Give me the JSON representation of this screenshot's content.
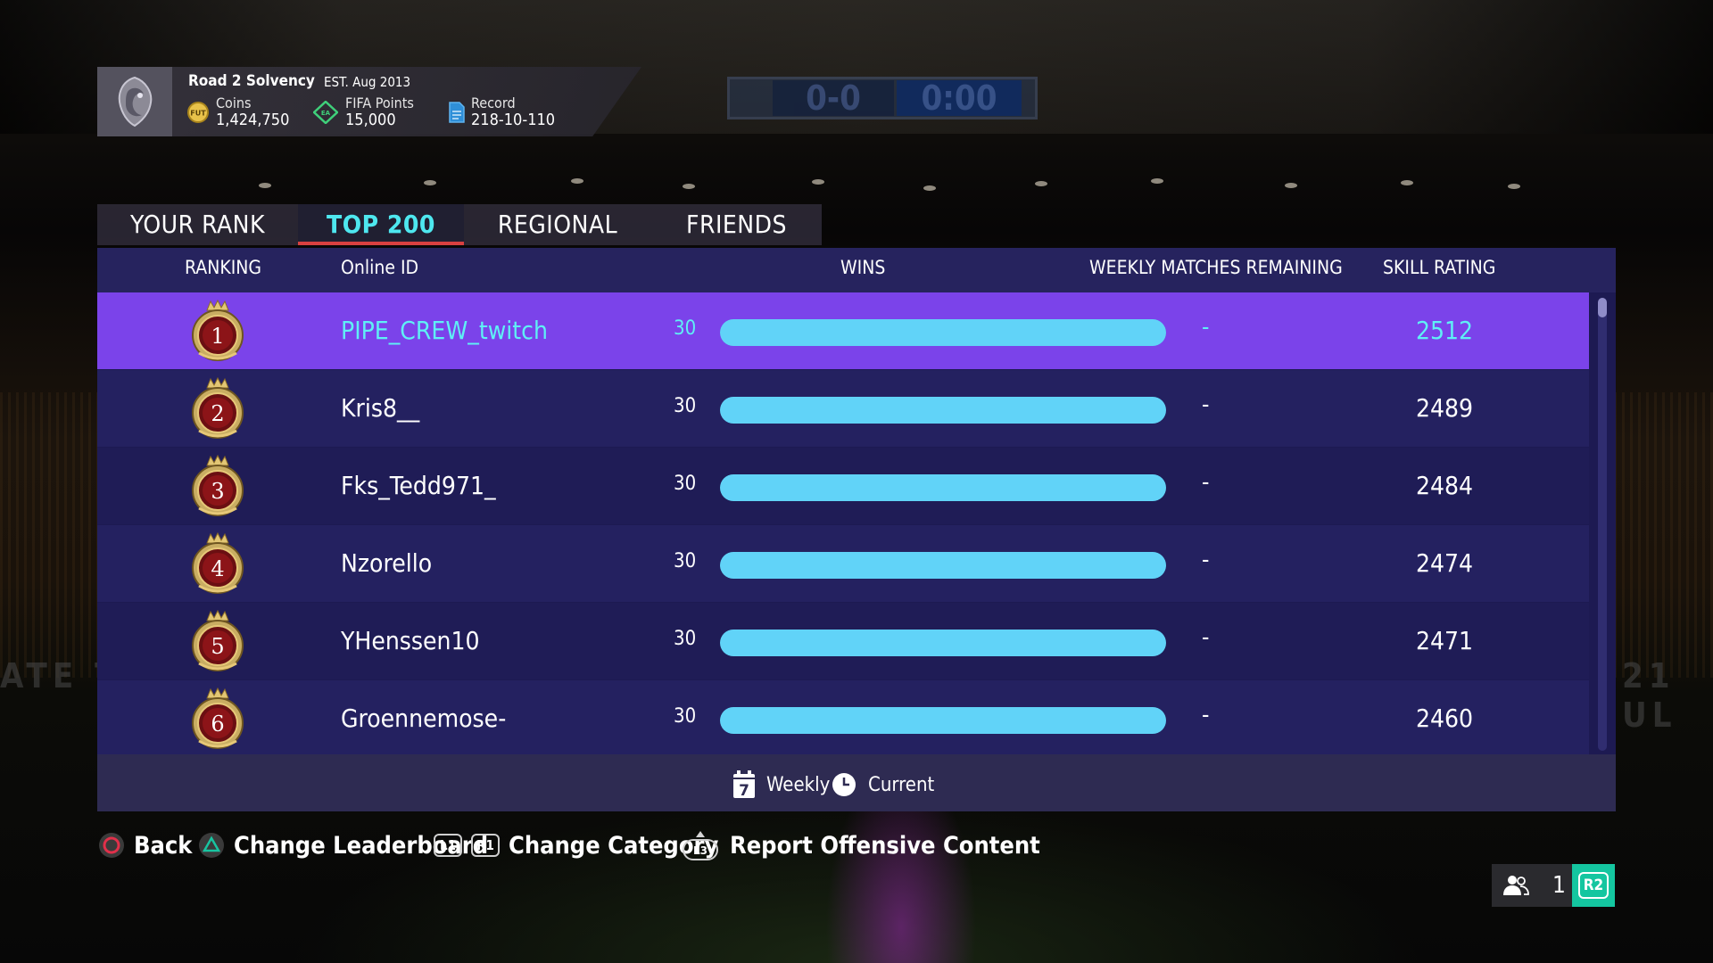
{
  "background": {
    "scoreboard_home": "0-0",
    "scoreboard_time": "0:00",
    "banner_left": "ATE T",
    "banner_right": "21 UL"
  },
  "profile": {
    "club_name": "Road 2 Solvency",
    "established": "EST. Aug 2013",
    "coins_label": "Coins",
    "coins_value": "1,424,750",
    "fifa_points_label": "FIFA Points",
    "fifa_points_value": "15,000",
    "record_label": "Record",
    "record_value": "218-10-110",
    "coin_icon_text": "FUT",
    "points_icon_text": "EA"
  },
  "tabs": [
    {
      "label": "YOUR RANK",
      "active": false
    },
    {
      "label": "TOP 200",
      "active": true
    },
    {
      "label": "REGIONAL",
      "active": false
    },
    {
      "label": "FRIENDS",
      "active": false
    }
  ],
  "columns": {
    "ranking": "RANKING",
    "online_id": "Online ID",
    "wins": "WINS",
    "weekly_remaining": "WEEKLY MATCHES REMAINING",
    "skill_rating": "SKILL RATING"
  },
  "max_wins": 30,
  "rows": [
    {
      "rank": "1",
      "online_id": "PIPE_CREW_twitch",
      "wins": 30,
      "weekly_remaining": "-",
      "skill_rating": "2512",
      "selected": true
    },
    {
      "rank": "2",
      "online_id": "Kris8__",
      "wins": 30,
      "weekly_remaining": "-",
      "skill_rating": "2489",
      "selected": false
    },
    {
      "rank": "3",
      "online_id": "Fks_Tedd971_",
      "wins": 30,
      "weekly_remaining": "-",
      "skill_rating": "2484",
      "selected": false
    },
    {
      "rank": "4",
      "online_id": "Nzorello",
      "wins": 30,
      "weekly_remaining": "-",
      "skill_rating": "2474",
      "selected": false
    },
    {
      "rank": "5",
      "online_id": "YHenssen10",
      "wins": 30,
      "weekly_remaining": "-",
      "skill_rating": "2471",
      "selected": false
    },
    {
      "rank": "6",
      "online_id": "Groennemose-",
      "wins": 30,
      "weekly_remaining": "-",
      "skill_rating": "2460",
      "selected": false
    }
  ],
  "legend": {
    "weekly_label": "Weekly",
    "weekly_icon_text": "7",
    "current_label": "Current"
  },
  "footer": {
    "back_label": "Back",
    "change_leaderboard_label": "Change Leaderboard",
    "l1_key": "L1",
    "r1_key": "R1",
    "change_category_label": "Change Category",
    "l3_key": "L3",
    "report_label": "Report Offensive Content"
  },
  "online_widget": {
    "count": "1",
    "key": "R2"
  },
  "colors": {
    "accent_cyan": "#5ff0f5",
    "selected_row": "#7b43ea",
    "wins_bar": "#61d3f8",
    "panel": "#1d1a52",
    "r2_green": "#14c6a0",
    "circle_button": "#e0304a",
    "triangle_button": "#18c4a0"
  }
}
